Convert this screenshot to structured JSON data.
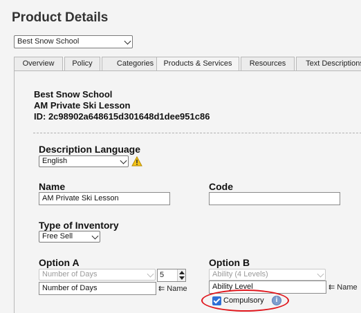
{
  "page": {
    "title": "Product Details"
  },
  "school_select": {
    "value": "Best Snow School"
  },
  "tabs": [
    {
      "label": "Overview"
    },
    {
      "label": "Policy"
    },
    {
      "label": "Categories"
    },
    {
      "label": "Products & Services",
      "active": true
    },
    {
      "label": "Resources"
    },
    {
      "label": "Text Descriptions"
    }
  ],
  "product": {
    "school": "Best Snow School",
    "name": "AM Private Ski Lesson",
    "id_line": "ID: 2c98902a648615d301648d1dee951c86"
  },
  "description_language": {
    "label": "Description Language",
    "value": "English"
  },
  "name_field": {
    "label": "Name",
    "value": "AM Private Ski Lesson"
  },
  "code_field": {
    "label": "Code",
    "value": ""
  },
  "inventory": {
    "label": "Type of Inventory",
    "value": "Free Sell"
  },
  "option_a": {
    "label": "Option A",
    "select_value": "Number of Days",
    "quantity": "5",
    "name_value": "Number of Days",
    "name_hint": "⇇ Name"
  },
  "option_b": {
    "label": "Option B",
    "select_value": "Ability (4 Levels)",
    "name_value": "Ability Level",
    "name_hint": "⇇ Name",
    "compulsory_label": "Compulsory",
    "compulsory_checked": true
  },
  "icons": {
    "warning": "warning-icon",
    "info": "info-icon"
  },
  "colors": {
    "highlight": "#e0161c",
    "checkbox": "#2f6fd6"
  }
}
